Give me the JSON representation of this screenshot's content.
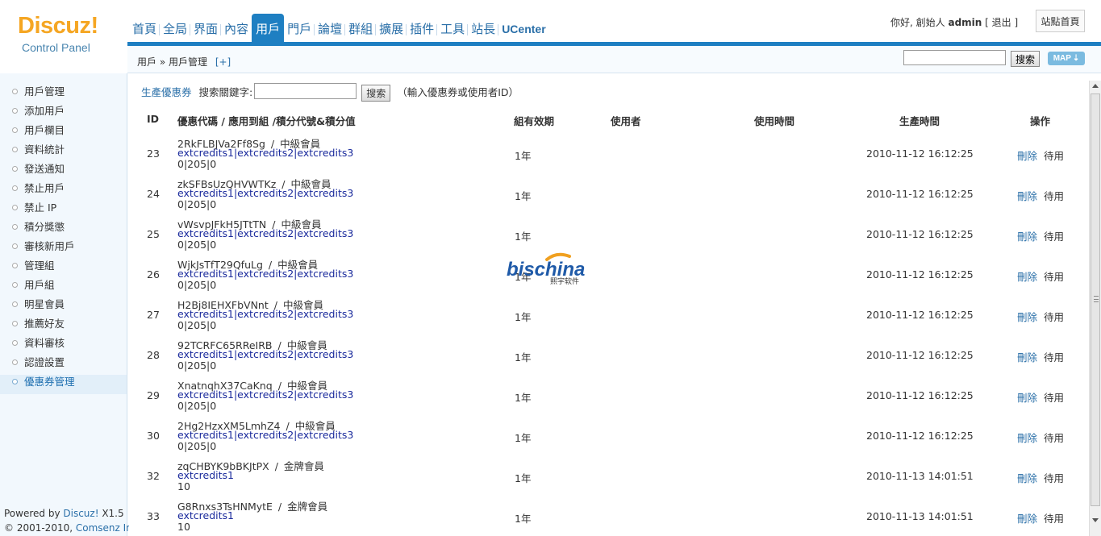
{
  "logo": {
    "main": "Discuz!",
    "sub": "Control Panel"
  },
  "topnav": {
    "items": [
      "首頁",
      "全局",
      "界面",
      "內容",
      "用戶",
      "門戶",
      "論壇",
      "群組",
      "擴展",
      "插件",
      "工具",
      "站長",
      "UCenter"
    ],
    "active": "用戶"
  },
  "userinfo": {
    "greeting": "你好, 創始人",
    "username": "admin",
    "logout_open": "[",
    "logout": "退出",
    "logout_close": "]"
  },
  "sitehome_button": "站點首頁",
  "breadcrumb": {
    "path": "用戶 » 用戶管理",
    "plus": "[+]"
  },
  "header_search": {
    "button": "搜索",
    "map_label": "MAP"
  },
  "sidebar": {
    "items": [
      "用戶管理",
      "添加用戶",
      "用戶欄目",
      "資料統計",
      "發送通知",
      "禁止用戶",
      "禁止 IP",
      "積分獎懲",
      "審核新用戶",
      "管理組",
      "用戶組",
      "明星會員",
      "推薦好友",
      "資料審核",
      "認證設置",
      "優惠券管理"
    ],
    "active_index": 15,
    "powered_prefix": "Powered by ",
    "powered_link": "Discuz!",
    "powered_version": " X1.5",
    "copyright_prefix": "© 2001-2010, ",
    "copyright_link": "Comsenz Inc."
  },
  "toolbar": {
    "generate_link": "生產優惠券",
    "keyword_label": "搜索關鍵字:",
    "search_button": "搜索",
    "hint": "（輸入優惠券或使用者ID）"
  },
  "table": {
    "headers": {
      "id": "ID",
      "code": "優惠代碼  /  應用到組  /積分代號&積分值",
      "validity": "組有效期",
      "user": "使用者",
      "use_time": "使用時間",
      "gen_time": "生產時間",
      "ops": "操作"
    },
    "rows": [
      {
        "id": "23",
        "code": "2RkFLBJVa2Ff8Sg",
        "sep": "/",
        "group": "中級會員",
        "credits": "extcredits1|extcredits2|extcredits3",
        "values": "0|205|0",
        "validity": "1年",
        "gen_time": "2010-11-12 16:12:25",
        "delete": "刪除",
        "disable": "待用"
      },
      {
        "id": "24",
        "code": "zkSFBsUzQHVWTKz",
        "sep": "/",
        "group": "中級會員",
        "credits": "extcredits1|extcredits2|extcredits3",
        "values": "0|205|0",
        "validity": "1年",
        "gen_time": "2010-11-12 16:12:25",
        "delete": "刪除",
        "disable": "待用"
      },
      {
        "id": "25",
        "code": "vWsvpJFkH5JTtTN",
        "sep": "/",
        "group": "中級會員",
        "credits": "extcredits1|extcredits2|extcredits3",
        "values": "0|205|0",
        "validity": "1年",
        "gen_time": "2010-11-12 16:12:25",
        "delete": "刪除",
        "disable": "待用"
      },
      {
        "id": "26",
        "code": "WjkJsTfT29QfuLg",
        "sep": "/",
        "group": "中級會員",
        "credits": "extcredits1|extcredits2|extcredits3",
        "values": "0|205|0",
        "validity": "1年",
        "gen_time": "2010-11-12 16:12:25",
        "delete": "刪除",
        "disable": "待用"
      },
      {
        "id": "27",
        "code": "H2Bj8IEHXFbVNnt",
        "sep": "/",
        "group": "中級會員",
        "credits": "extcredits1|extcredits2|extcredits3",
        "values": "0|205|0",
        "validity": "1年",
        "gen_time": "2010-11-12 16:12:25",
        "delete": "刪除",
        "disable": "待用"
      },
      {
        "id": "28",
        "code": "92TCRFC65RReIRB",
        "sep": "/",
        "group": "中級會員",
        "credits": "extcredits1|extcredits2|extcredits3",
        "values": "0|205|0",
        "validity": "1年",
        "gen_time": "2010-11-12 16:12:25",
        "delete": "刪除",
        "disable": "待用"
      },
      {
        "id": "29",
        "code": "XnatnqhX37CaKnq",
        "sep": "/",
        "group": "中級會員",
        "credits": "extcredits1|extcredits2|extcredits3",
        "values": "0|205|0",
        "validity": "1年",
        "gen_time": "2010-11-12 16:12:25",
        "delete": "刪除",
        "disable": "待用"
      },
      {
        "id": "30",
        "code": "2Hg2HzxXM5LmhZ4",
        "sep": "/",
        "group": "中級會員",
        "credits": "extcredits1|extcredits2|extcredits3",
        "values": "0|205|0",
        "validity": "1年",
        "gen_time": "2010-11-12 16:12:25",
        "delete": "刪除",
        "disable": "待用"
      },
      {
        "id": "32",
        "code": "zqCHBYK9bBKJtPX",
        "sep": "/",
        "group": "金牌會員",
        "credits": "extcredits1",
        "values": "10",
        "validity": "1年",
        "gen_time": "2010-11-13 14:01:51",
        "delete": "刪除",
        "disable": "待用"
      },
      {
        "id": "33",
        "code": "G8Rnxs3TsHNMytE",
        "sep": "/",
        "group": "金牌會員",
        "credits": "extcredits1",
        "values": "10",
        "validity": "1年",
        "gen_time": "2010-11-13 14:01:51",
        "delete": "刪除",
        "disable": "待用"
      }
    ]
  },
  "watermark": {
    "brand": "bischina",
    "sub": "熙宇软件"
  },
  "colors": {
    "accent": "#1e7fc2",
    "link": "#2a6fa8",
    "credits": "#1a2a9c",
    "logo": "#f5a623"
  }
}
